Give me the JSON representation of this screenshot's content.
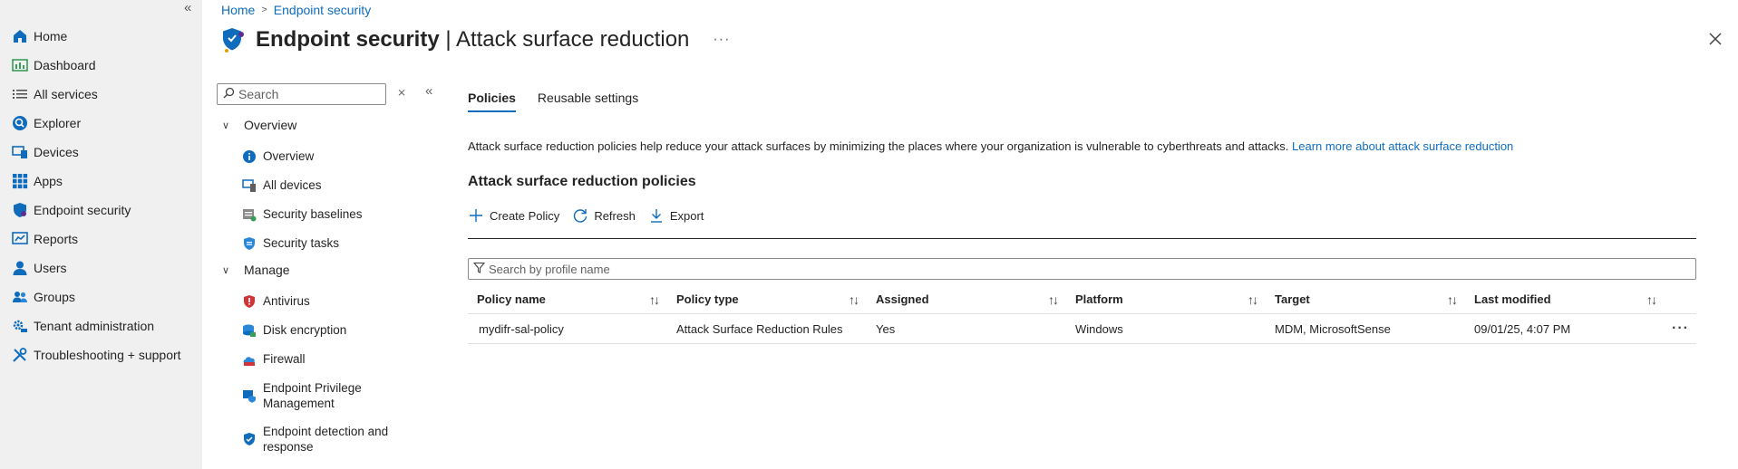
{
  "leftnav": {
    "items": [
      {
        "label": "Home",
        "icon": "home-icon"
      },
      {
        "label": "Dashboard",
        "icon": "dashboard-icon"
      },
      {
        "label": "All services",
        "icon": "list-icon"
      },
      {
        "label": "Explorer",
        "icon": "explorer-icon"
      },
      {
        "label": "Devices",
        "icon": "devices-icon"
      },
      {
        "label": "Apps",
        "icon": "apps-icon"
      },
      {
        "label": "Endpoint security",
        "icon": "shield-icon"
      },
      {
        "label": "Reports",
        "icon": "reports-icon"
      },
      {
        "label": "Users",
        "icon": "user-icon"
      },
      {
        "label": "Groups",
        "icon": "groups-icon"
      },
      {
        "label": "Tenant administration",
        "icon": "tenant-admin-icon"
      },
      {
        "label": "Troubleshooting + support",
        "icon": "wrench-icon"
      }
    ]
  },
  "breadcrumb": {
    "home": "Home",
    "current": "Endpoint security"
  },
  "header": {
    "title_main": "Endpoint security",
    "title_separator": " | ",
    "title_sub": "Attack surface reduction",
    "more": "···"
  },
  "submenu": {
    "search_placeholder": "Search",
    "groups": [
      {
        "label": "Overview",
        "items": [
          "Overview",
          "All devices",
          "Security baselines",
          "Security tasks"
        ]
      },
      {
        "label": "Manage",
        "items": [
          "Antivirus",
          "Disk encryption",
          "Firewall",
          "Endpoint Privilege Management",
          "Endpoint detection and response"
        ]
      }
    ]
  },
  "tabs": [
    "Policies",
    "Reusable settings"
  ],
  "description": {
    "text": "Attack surface reduction policies help reduce your attack surfaces by minimizing the places where your organization is vulnerable to cyberthreats and attacks. ",
    "link": "Learn more about attack surface reduction"
  },
  "section_title": "Attack surface reduction policies",
  "toolbar": {
    "create": "Create Policy",
    "refresh": "Refresh",
    "export": "Export"
  },
  "filter": {
    "placeholder": "Search by profile name"
  },
  "table": {
    "columns": [
      "Policy name",
      "Policy type",
      "Assigned",
      "Platform",
      "Target",
      "Last modified"
    ],
    "rows": [
      [
        "mydifr-sal-policy",
        "Attack Surface Reduction Rules",
        "Yes",
        "Windows",
        "MDM, MicrosoftSense",
        "09/01/25, 4:07 PM"
      ]
    ]
  },
  "colors": {
    "accent": "#0f6cbd",
    "nav_bg": "#f0f0f0"
  }
}
